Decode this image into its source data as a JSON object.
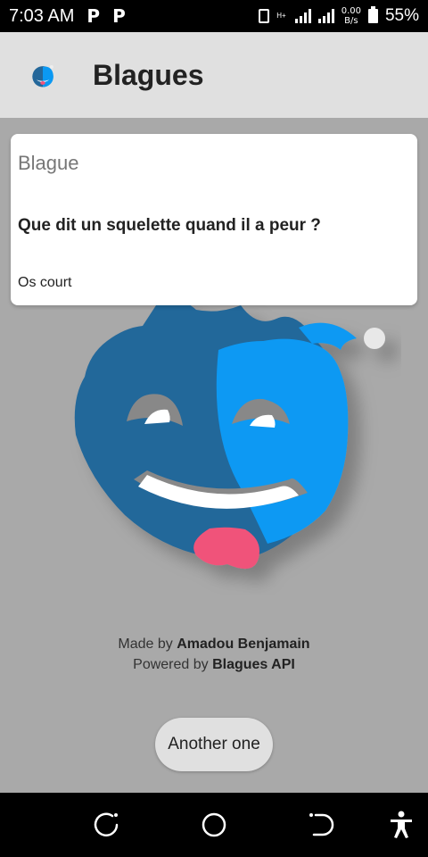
{
  "status_bar": {
    "time": "7:03 AM",
    "notifications": [
      "P",
      "P"
    ],
    "network_type": "H+",
    "speed_value": "0.00",
    "speed_unit": "B/s",
    "battery": "55%"
  },
  "app_bar": {
    "title": "Blagues",
    "logo_icon": "jester-mascot-icon"
  },
  "joke_card": {
    "title": "Blague",
    "question": "Que dit un squelette quand il a peur ?",
    "answer": "Os court"
  },
  "credits": {
    "made_by_prefix": "Made by ",
    "author": "Amadou Benjamain",
    "powered_by_prefix": "Powered by ",
    "api": "Blagues API"
  },
  "action_button": {
    "label": "Another one"
  },
  "nav_bar": {
    "icons": [
      "recent-apps-icon",
      "home-icon",
      "back-icon",
      "accessibility-icon"
    ]
  },
  "colors": {
    "mascot_dark": "#24679a",
    "mascot_light": "#0b99f3",
    "tongue": "#f0527a",
    "background": "#a9a9a9"
  }
}
